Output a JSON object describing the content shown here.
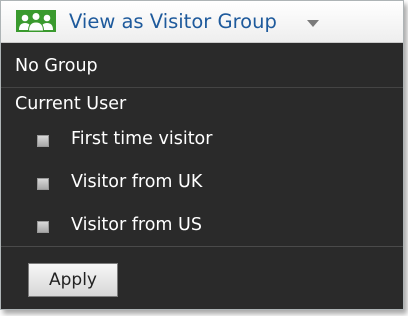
{
  "header": {
    "icon": "users-group-icon",
    "label": "View as Visitor Group",
    "caret_icon": "caret-down-icon",
    "label_color": "#1e5a9c"
  },
  "menu": {
    "items": [
      {
        "label": "No Group"
      },
      {
        "label": "Current User"
      }
    ],
    "visitor_groups": [
      {
        "label": "First time visitor",
        "checked": false
      },
      {
        "label": "Visitor from UK",
        "checked": false
      },
      {
        "label": "Visitor from US",
        "checked": false
      }
    ],
    "background_color": "#2a2a2a"
  },
  "footer": {
    "apply_label": "Apply"
  },
  "colors": {
    "icon_green": "#3a9a2e",
    "text_white": "#ffffff"
  }
}
